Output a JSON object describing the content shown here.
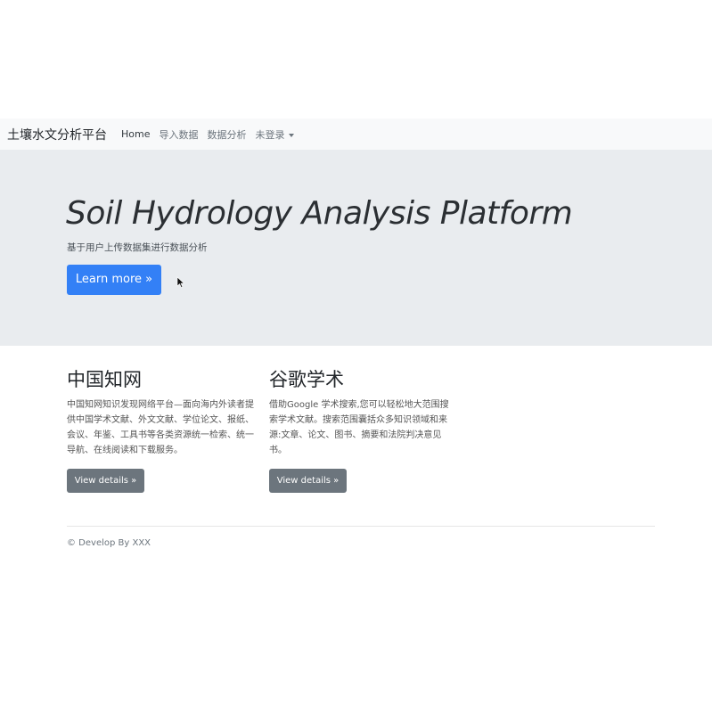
{
  "navbar": {
    "brand": "土壤水文分析平台",
    "links": [
      "Home",
      "导入数据",
      "数据分析"
    ],
    "user_menu": "未登录"
  },
  "jumbotron": {
    "title": "Soil Hydrology Analysis Platform",
    "subtitle": "基于用户上传数据集进行数据分析",
    "button_label": "Learn more »"
  },
  "columns": [
    {
      "heading": "中国知网",
      "text": "中国知网知识发现网络平台—面向海内外读者提供中国学术文献、外文文献、学位论文、报纸、会议、年鉴、工具书等各类资源统一检索、统一导航、在线阅读和下载服务。",
      "button_label": "View details »"
    },
    {
      "heading": "谷歌学术",
      "text": "借助Google 学术搜索,您可以轻松地大范围搜索学术文献。搜索范围囊括众多知识领域和来源:文章、论文、图书、摘要和法院判决意见书。",
      "button_label": "View details »"
    }
  ],
  "footer": {
    "text": "© Develop By XXX"
  },
  "colors": {
    "primary": "#3380f6",
    "secondary": "#6c757d",
    "jumbotron_bg": "#e9ecef",
    "navbar_bg": "#f8f9fa"
  }
}
